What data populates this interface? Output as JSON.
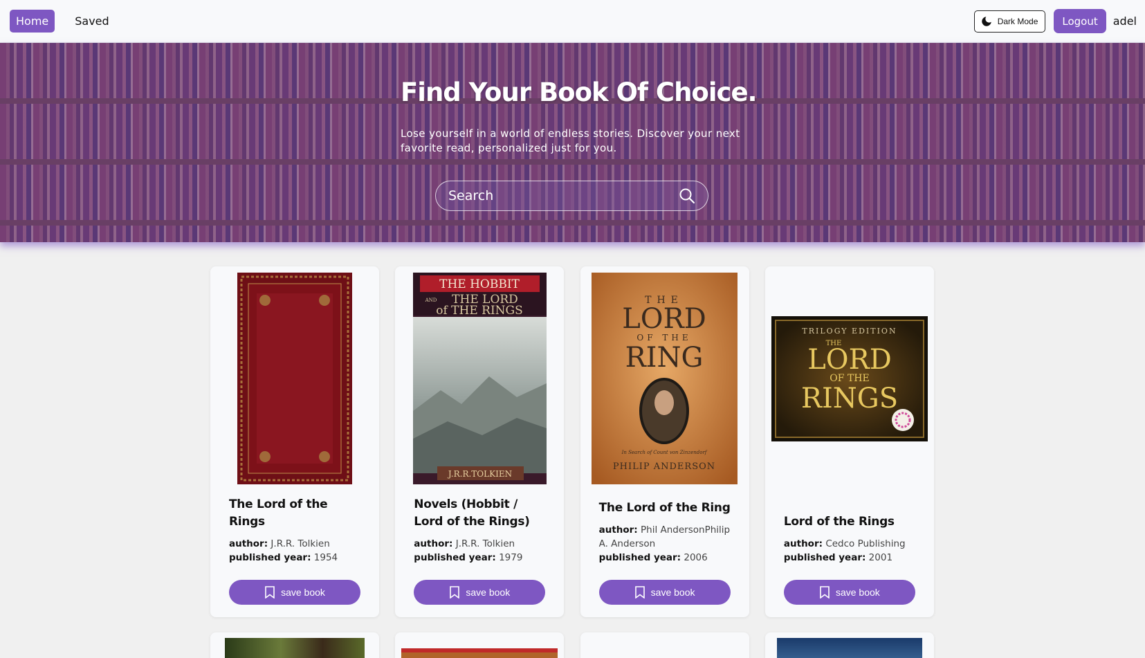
{
  "nav": {
    "home_label": "Home",
    "saved_label": "Saved",
    "dark_mode_label": "Dark Mode",
    "logout_label": "Logout",
    "username": "adel"
  },
  "hero": {
    "title": "Find Your Book Of Choice.",
    "subtitle": "Lose yourself in a world of endless stories. Discover your next favorite read, personalized just for you.",
    "search_placeholder": "Search"
  },
  "labels": {
    "author": "author:",
    "published_year": "published year:",
    "save_button": "save book"
  },
  "books": [
    {
      "title": "The Lord of the Rings",
      "author": "J.R.R. Tolkien",
      "published_year": "1954"
    },
    {
      "title": "Novels (Hobbit / Lord of the Rings)",
      "author": "J.R.R. Tolkien",
      "published_year": "1979",
      "cover_text": [
        "THE HOBBIT",
        "AND",
        "THE LORD",
        "of THE RINGS",
        "J.R.R.TOLKIEN"
      ]
    },
    {
      "title": "The Lord of the Ring",
      "author": "Phil AndersonPhilip A. Anderson",
      "published_year": "2006",
      "cover_text": [
        "THE",
        "LORD",
        "OF THE",
        "RING",
        "In Search of Count von Zinzendorf",
        "PHILIP ANDERSON"
      ]
    },
    {
      "title": "Lord of the Rings",
      "author": "Cedco Publishing",
      "published_year": "2001",
      "cover_text": [
        "TRILOGY EDITION",
        "THE",
        "LORD",
        "OF THE",
        "RINGS"
      ]
    }
  ],
  "colors": {
    "accent": "#7e57c2",
    "navbar_bg": "#f8f9fb",
    "page_bg": "#f0f0f0"
  },
  "icons": {
    "dark_mode": "moon-icon",
    "search": "search-icon",
    "save": "bookmark-icon"
  }
}
